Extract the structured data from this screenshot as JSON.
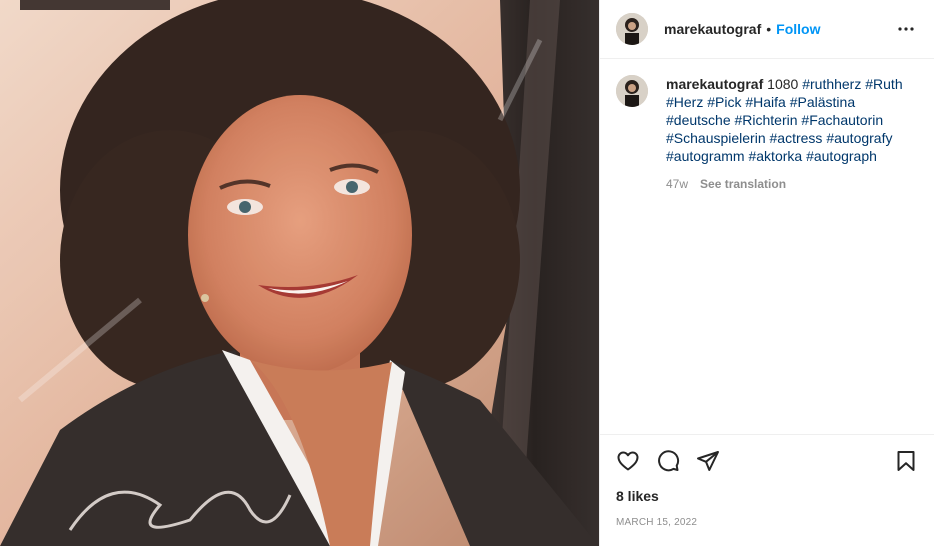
{
  "post": {
    "username": "marekautograf",
    "separator": "•",
    "follow_label": "Follow",
    "more_icon": "more-options-icon",
    "caption": {
      "username": "marekautograf",
      "text": "1080",
      "hashtags": [
        "#ruthherz",
        "#Ruth",
        "#Herz",
        "#Pick",
        "#Haifa",
        "#Palästina",
        "#deutsche",
        "#Richterin",
        "#Fachautorin",
        "#Schauspielerin",
        "#actress",
        "#autografy",
        "#autogramm",
        "#aktorka",
        "#autograph"
      ],
      "age": "47w",
      "see_translation": "See translation"
    },
    "actions": {
      "like_icon": "heart-icon",
      "comment_icon": "comment-icon",
      "share_icon": "share-icon",
      "save_icon": "bookmark-icon"
    },
    "likes": "8 likes",
    "date": "MARCH 15, 2022"
  }
}
